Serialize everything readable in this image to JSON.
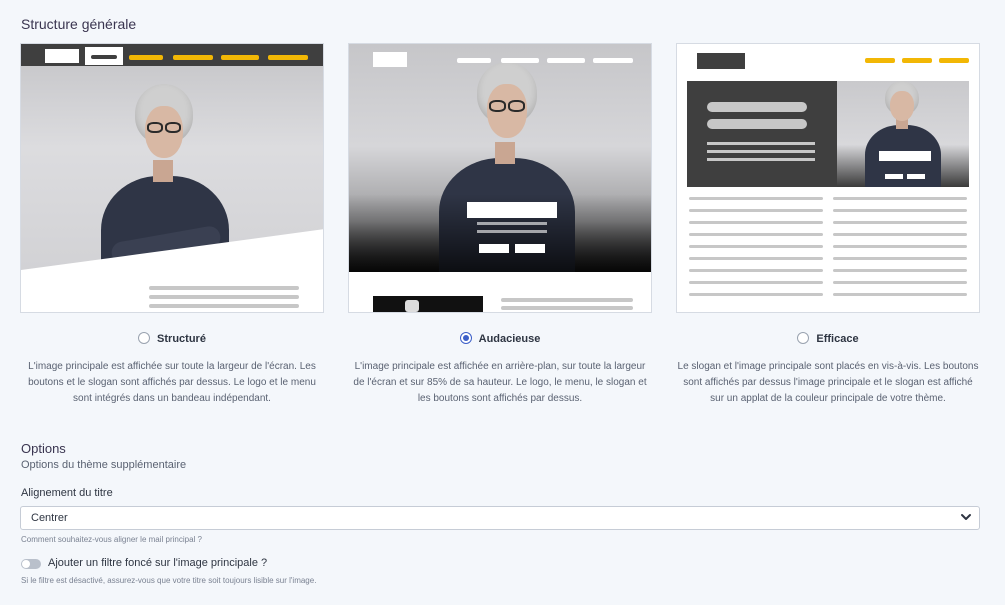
{
  "structure": {
    "title": "Structure générale",
    "options": [
      {
        "label": "Structuré",
        "selected": false,
        "description": "L'image principale est affichée sur toute la largeur de l'écran. Les boutons et le slogan sont affichés par dessus. Le logo et le menu sont intégrés dans un bandeau indépendant."
      },
      {
        "label": "Audacieuse",
        "selected": true,
        "description": "L'image principale est affichée en arrière-plan, sur toute la largeur de l'écran et sur 85% de sa hauteur. Le logo, le menu, le slogan et les boutons sont affichés par dessus."
      },
      {
        "label": "Efficace",
        "selected": false,
        "description": "Le slogan et l'image principale sont placés en vis-à-vis. Les boutons sont affichés par dessus l'image principale et le slogan est affiché sur un applat de la couleur principale de votre thème."
      }
    ]
  },
  "options": {
    "title": "Options",
    "subtitle": "Options du thème supplémentaire",
    "alignment": {
      "label": "Alignement du titre",
      "value": "Centrer",
      "help": "Comment souhaitez-vous aligner le mail principal ?"
    },
    "filter": {
      "label": "Ajouter un filtre foncé sur l'image principale ?",
      "enabled": false,
      "help": "Si le filtre est désactivé, assurez-vous que votre titre soit toujours lisible sur l'image."
    }
  },
  "colors": {
    "accent": "#3c5fc8",
    "menu_yellow": "#f2b705",
    "dark": "#3f3f3f"
  }
}
